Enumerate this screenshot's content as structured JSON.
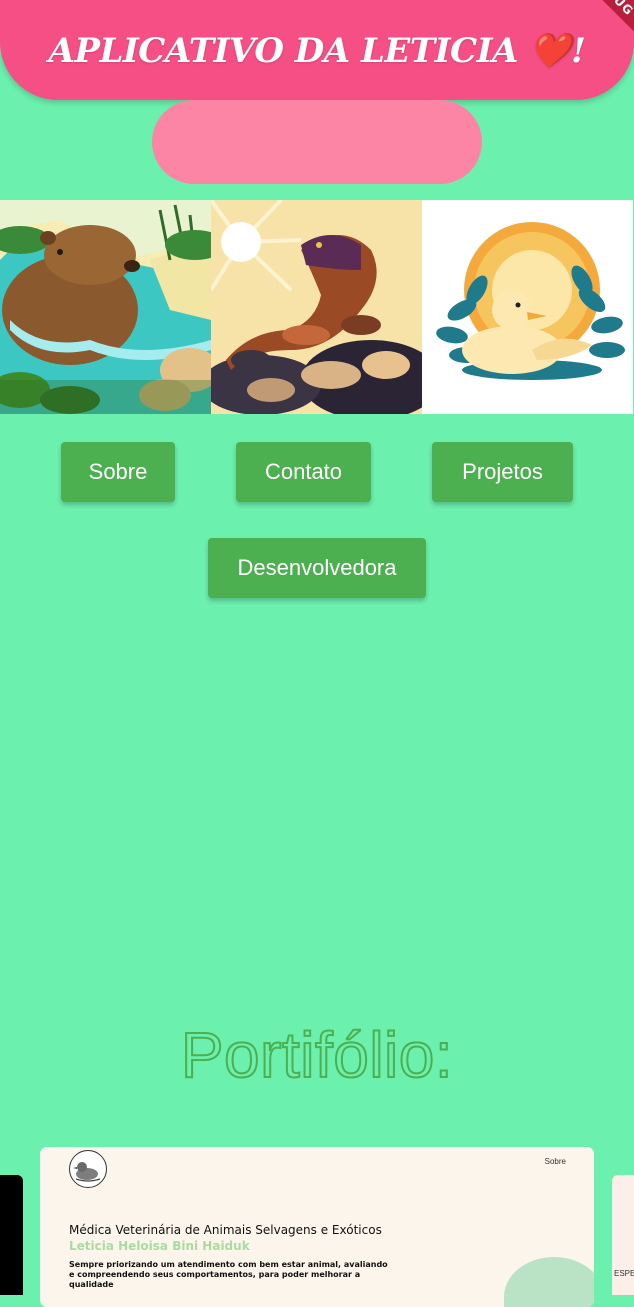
{
  "header": {
    "title": "APLICATIVO DA LETICIA ❤️!",
    "debug_banner": "DEBUG"
  },
  "gallery": {
    "images": [
      {
        "icon": "capybara-illustration",
        "alt": "capivara"
      },
      {
        "icon": "lizard-illustration",
        "alt": "lagarto"
      },
      {
        "icon": "duck-illustration",
        "alt": "pato"
      }
    ]
  },
  "nav": {
    "sobre": "Sobre",
    "contato": "Contato",
    "projetos": "Projetos",
    "desenvolvedora": "Desenvolvedora"
  },
  "portfolio": {
    "title": "Portifólio:",
    "card": {
      "nav_label": "Sobre",
      "heading": "Médica Veterinária de Animais Selvagens e Exóticos",
      "name": "Leticia Heloisa Bini Haiduk",
      "description": "Sempre priorizando um atendimento com bem estar animal, avaliando e compreendendo seus comportamentos, para poder melhorar a qualidade"
    },
    "next_card_text": "ESPE"
  },
  "colors": {
    "background": "#6cf0ae",
    "header": "#f54f85",
    "pill": "#fc85a6",
    "button": "#4caf50"
  }
}
